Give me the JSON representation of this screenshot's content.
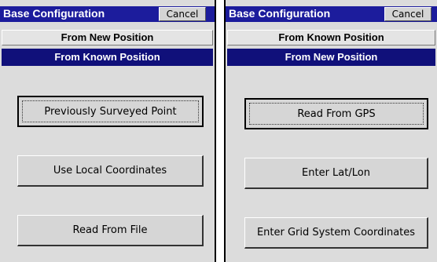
{
  "left_dialog": {
    "title": "Base Configuration",
    "cancel_label": "Cancel",
    "tabs": [
      {
        "label": "From New Position",
        "active": false
      },
      {
        "label": "From Known Position",
        "active": true
      }
    ],
    "buttons": [
      {
        "label": "Previously Surveyed Point",
        "default": true
      },
      {
        "label": "Use Local Coordinates",
        "default": false
      },
      {
        "label": "Read From File",
        "default": false
      }
    ]
  },
  "right_dialog": {
    "title": "Base Configuration",
    "cancel_label": "Cancel",
    "tabs": [
      {
        "label": "From Known Position",
        "active": false
      },
      {
        "label": "From New Position",
        "active": true
      }
    ],
    "buttons": [
      {
        "label": "Read From GPS",
        "default": true
      },
      {
        "label": "Enter Lat/Lon",
        "default": false
      },
      {
        "label": "Enter Grid System Coordinates",
        "default": false
      }
    ]
  },
  "colors": {
    "title_bar": "#1c1c9c",
    "active_tab": "#10107a",
    "dialog_bg": "#dcdcdc"
  }
}
